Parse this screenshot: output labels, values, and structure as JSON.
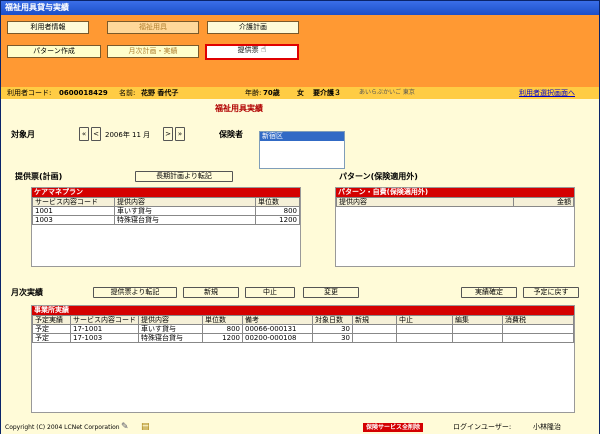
{
  "window": {
    "title": "福祉用具貸与実績"
  },
  "nav1": {
    "user_info": "利用者情報",
    "welfare": "福祉用具",
    "care_plan": "介護計画"
  },
  "nav2": {
    "pattern": "パターン作成",
    "monthly": "月次計画・実績",
    "provision": "提供票"
  },
  "info": {
    "user_code_label": "利用者コード:",
    "user_code": "0600018429",
    "name_label": "名前:",
    "name": "花野 香代子",
    "age_label": "年齢:",
    "age": "70歳",
    "gender": "女",
    "care_level": "要介護３",
    "kana": "あいらぶかいご 東京",
    "select_link": "利用者選択画面へ"
  },
  "section_title": "福祉用具実績",
  "period": {
    "label": "対象月",
    "value": "2006年 11 月",
    "first": "«",
    "prev": "<",
    "next": ">",
    "last": "»"
  },
  "insurer": {
    "label": "保険者",
    "selected": "新宿区"
  },
  "plan": {
    "label": "提供票(計画)",
    "transfer_button": "長期計画より転記",
    "panel_title": "ケアマネプラン",
    "columns": [
      "サービス内容コード",
      "提供内容",
      "単位数"
    ],
    "rows": [
      [
        "1001",
        "車いす貸与",
        "800"
      ],
      [
        "1003",
        "特殊寝台貸与",
        "1200"
      ]
    ]
  },
  "pattern_out": {
    "label": "パターン(保険適用外)",
    "panel_title": "パターン・自費(保険適用外)",
    "columns": [
      "提供内容",
      "金額"
    ]
  },
  "monthly": {
    "label": "月次実績",
    "btn_transfer": "提供票より転記",
    "btn_new": "新規",
    "btn_cancel": "中止",
    "btn_change": "変更",
    "btn_confirm": "実績確定",
    "btn_revert": "予定に戻す",
    "panel_title": "事業所実績",
    "columns": [
      "予定実績",
      "サービス内容コード",
      "提供内容",
      "単位数",
      "備考",
      "対象日数",
      "新規",
      "中止",
      "編集",
      "消費税"
    ],
    "rows": [
      [
        "予定",
        "17-1001",
        "車いす貸与",
        "800",
        "00066-000131",
        "30",
        "",
        "",
        "",
        ""
      ],
      [
        "予定",
        "17-1003",
        "特殊寝台貸与",
        "1200",
        "00200-000108",
        "30",
        "",
        "",
        "",
        ""
      ]
    ]
  },
  "footer": {
    "copyright": "Copyright (C) 2004 LCNet Corporation",
    "delete_all": "保険サービス全削除",
    "login_label": "ログインユーザー:",
    "login_user": "小林隆治"
  }
}
